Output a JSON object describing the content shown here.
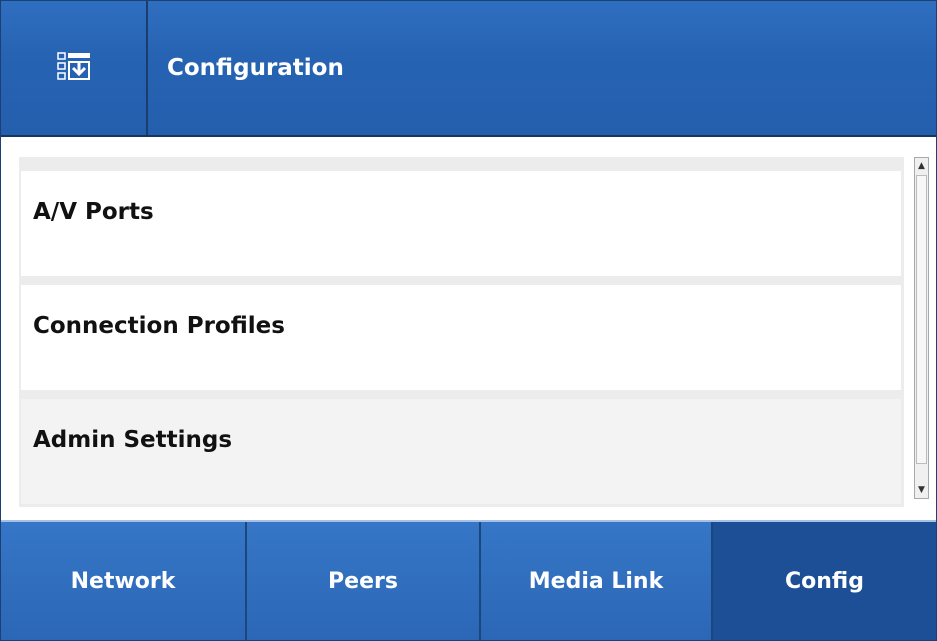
{
  "header": {
    "icon": "config-download-icon",
    "title": "Configuration"
  },
  "list": {
    "items": [
      {
        "label": "A/V Ports"
      },
      {
        "label": "Connection Profiles"
      },
      {
        "label": "Admin Settings"
      }
    ]
  },
  "scrollbar": {
    "up_arrow": "▲",
    "down_arrow": "▼"
  },
  "tabs": [
    {
      "label": "Network",
      "active": false
    },
    {
      "label": "Peers",
      "active": false
    },
    {
      "label": "Media Link",
      "active": false
    },
    {
      "label": "Config",
      "active": true
    }
  ],
  "colors": {
    "header_blue": "#2a67b8",
    "tab_blue": "#2d6bb9",
    "active_tab": "#1c4f95",
    "text_white": "#ffffff"
  }
}
